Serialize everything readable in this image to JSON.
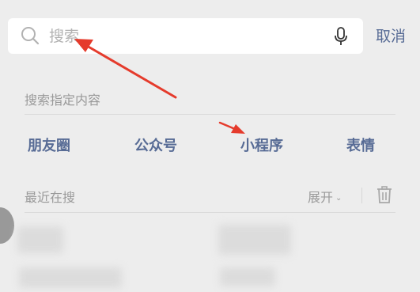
{
  "search": {
    "placeholder": "搜索",
    "cancel_label": "取消"
  },
  "section": {
    "label": "搜索指定内容"
  },
  "categories": [
    {
      "label": "朋友圈"
    },
    {
      "label": "公众号"
    },
    {
      "label": "小程序"
    },
    {
      "label": "表情"
    }
  ],
  "recent": {
    "label": "最近在搜",
    "expand_label": "展开"
  },
  "colors": {
    "background": "#ededed",
    "link_accent": "#576b95",
    "annotation_arrow": "#e53b2c"
  },
  "icons": [
    "search-icon",
    "microphone-icon",
    "chevron-down-icon",
    "trash-icon"
  ]
}
